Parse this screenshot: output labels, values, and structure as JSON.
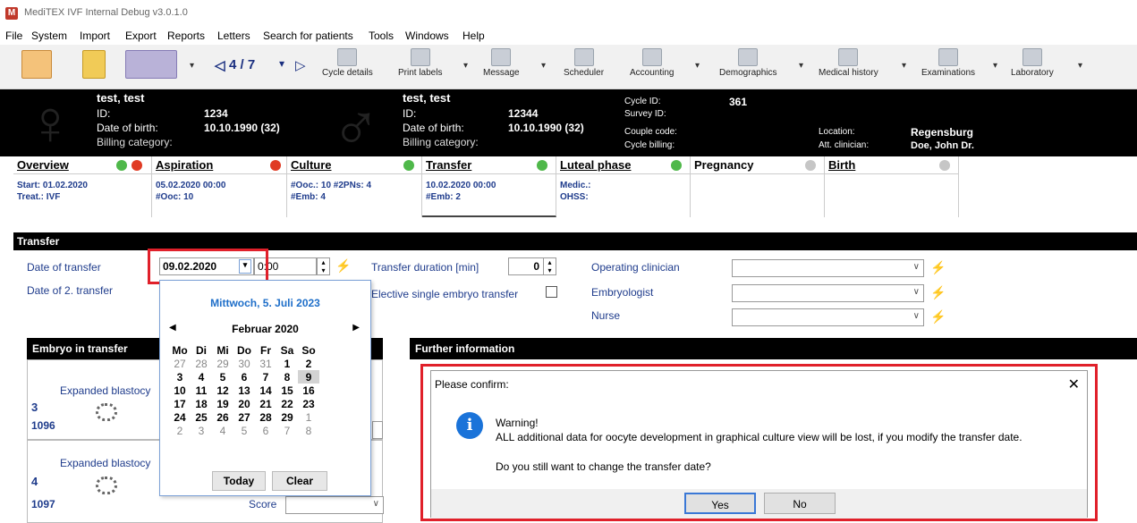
{
  "window": {
    "title": "MediTEX IVF Internal Debug v3.0.1.0"
  },
  "menu": [
    "File",
    "System",
    "Import",
    "Export",
    "Reports",
    "Letters",
    "Search for patients",
    "Tools",
    "Windows",
    "Help"
  ],
  "toolbar": {
    "pager": "4 / 7",
    "items": [
      "Cycle details",
      "Print labels",
      "Message",
      "Scheduler",
      "Accounting",
      "Demographics",
      "Medical history",
      "Examinations",
      "Laboratory"
    ]
  },
  "patient_left": {
    "name": "test, test",
    "id_label": "ID:",
    "id": "1234",
    "dob_label": "Date of birth:",
    "dob": "10.10.1990  (32)",
    "billing_label": "Billing category:"
  },
  "patient_right": {
    "name": "test, test",
    "id_label": "ID:",
    "id": "12344",
    "dob_label": "Date of birth:",
    "dob": "10.10.1990  (32)",
    "billing_label": "Billing category:"
  },
  "cycle": {
    "cycle_id_label": "Cycle ID:",
    "cycle_id": "361",
    "survey_label": "Survey ID:",
    "couple_label": "Couple code:",
    "billing_label": "Cycle billing:",
    "location_label": "Location:",
    "location": "Regensburg",
    "clinician_label": "Att. clinician:",
    "clinician": "Doe, John Dr."
  },
  "tabs": [
    {
      "title": "Overview",
      "l1": "Start: 01.02.2020",
      "l2": "Treat.: IVF"
    },
    {
      "title": "Aspiration",
      "l1": "05.02.2020 00:00",
      "l2": "#Ooc: 10"
    },
    {
      "title": "Culture",
      "l1": "#Ooc.: 10 #2PNs: 4",
      "l2": "#Emb: 4"
    },
    {
      "title": "Transfer",
      "l1": "10.02.2020 00:00",
      "l2": "#Emb: 2"
    },
    {
      "title": "Luteal phase",
      "l1": "Medic.:",
      "l2": "OHSS:"
    },
    {
      "title": "Pregnancy",
      "l1": "",
      "l2": ""
    },
    {
      "title": "Birth",
      "l1": "",
      "l2": ""
    }
  ],
  "transfer": {
    "section_title": "Transfer",
    "date_label": "Date of transfer",
    "date_value": "09.02.2020",
    "time_value": "0:00",
    "date2_label": "Date of 2. transfer",
    "duration_label": "Transfer duration [min]",
    "duration_value": "0",
    "elective_label": "Elective single embryo transfer",
    "op_clin_label": "Operating clinician",
    "embryologist_label": "Embryologist",
    "nurse_label": "Nurse"
  },
  "calendar": {
    "today_header": "Mittwoch, 5. Juli 2023",
    "month": "Februar 2020",
    "weekdays": [
      "Mo",
      "Di",
      "Mi",
      "Do",
      "Fr",
      "Sa",
      "So"
    ],
    "weeks": [
      [
        "27",
        "28",
        "29",
        "30",
        "31",
        "1",
        "2"
      ],
      [
        "3",
        "4",
        "5",
        "6",
        "7",
        "8",
        "9"
      ],
      [
        "10",
        "11",
        "12",
        "13",
        "14",
        "15",
        "16"
      ],
      [
        "17",
        "18",
        "19",
        "20",
        "21",
        "22",
        "23"
      ],
      [
        "24",
        "25",
        "26",
        "27",
        "28",
        "29",
        "1"
      ],
      [
        "2",
        "3",
        "4",
        "5",
        "6",
        "7",
        "8"
      ]
    ],
    "today_btn": "Today",
    "clear_btn": "Clear"
  },
  "embryo": {
    "section_title": "Embryo in transfer",
    "items": [
      {
        "stage": "Expanded blastocy",
        "num": "3",
        "id": "1096"
      },
      {
        "stage": "Expanded blastocy",
        "num": "4",
        "id": "1097"
      }
    ],
    "score_label": "Score"
  },
  "further": {
    "section_title": "Further information"
  },
  "dialog": {
    "title": "Please confirm:",
    "line1": "Warning!",
    "line2": "ALL additional data for oocyte development in graphical culture view will be lost, if you modify the transfer date.",
    "question": "Do you still want to change the transfer date?",
    "yes": "Yes",
    "no": "No"
  }
}
